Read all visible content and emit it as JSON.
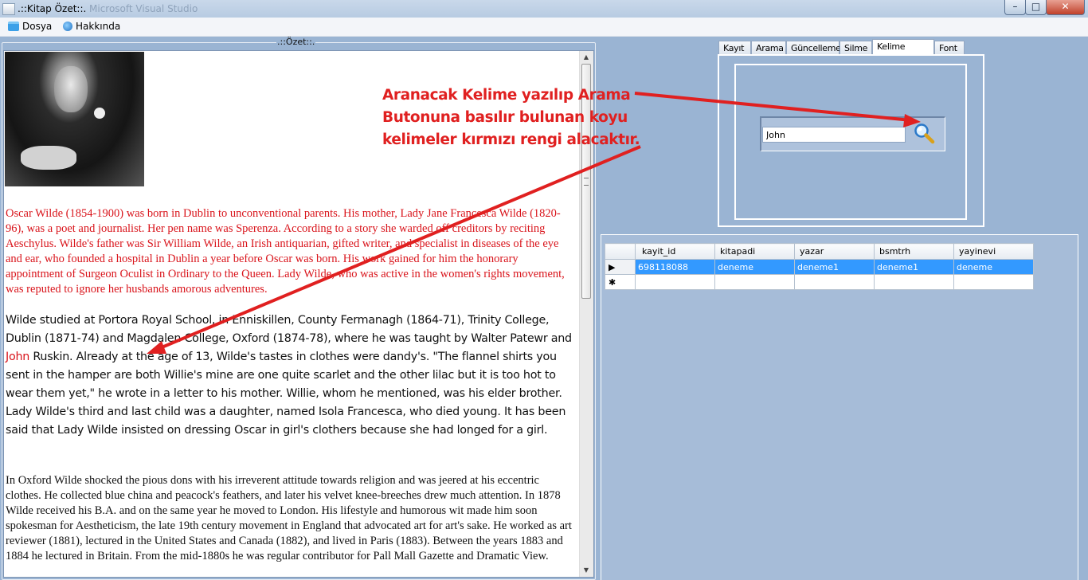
{
  "window": {
    "title": ".::Kitap Özet::.",
    "ghost_title": "Microsoft Visual Studio",
    "minimize": "–",
    "maximize": "□",
    "close": "✕"
  },
  "menu": {
    "items": [
      {
        "label": "Dosya",
        "icon": "folder-icon"
      },
      {
        "label": "Hakkında",
        "icon": "info-icon"
      }
    ]
  },
  "summary": {
    "group_label": ".::Özet::.",
    "paragraph1": "Oscar Wilde (1854-1900) was born in Dublin to unconventional parents. His mother, Lady Jane Francesca Wilde (1820-96), was a poet and journalist. Her pen name was Sperenza. According to a story she warded off creditors by reciting Aeschylus. Wilde's father was Sir William Wilde, an Irish antiquarian, gifted writer, and specialist in diseases of the eye and ear, who founded a hospital in Dublin a year before Oscar was born. His work gained for him the honorary appointment of Surgeon Oculist in Ordinary to the Queen. Lady Wilde, who was active in the women's rights movement, was reputed to ignore her husbands amorous adventures.",
    "paragraph2_before": "Wilde studied at Portora Royal School, in Enniskillen, County Fermanagh (1864-71), Trinity College, Dublin (1871-74) and Magdalen College, Oxford (1874-78), where he was taught by Walter Patewr and ",
    "paragraph2_highlight": "John",
    "paragraph2_after": " Ruskin. Already at the age of 13, Wilde's tastes in clothes were dandy's. \"The flannel shirts you sent in the hamper are both Willie's mine are one quite scarlet and the other lilac but it is too hot to wear them yet,\" he wrote in a letter to his mother. Willie, whom he mentioned, was his elder brother. Lady Wilde's third and last child was a daughter, named Isola Francesca, who died young. It has been said that Lady Wilde insisted on dressing Oscar in girl's clothers because she had longed for a girl.",
    "paragraph3": "In Oxford Wilde shocked the pious dons with his irreverent attitude towards religion and was jeered at his eccentric clothes. He collected blue china and peacock's feathers, and later his velvet knee-breeches drew much attention. In 1878 Wilde received his B.A. and on the same year he moved to London. His lifestyle and humorous wit made him soon spokesman for Aestheticism, the late 19th century movement in England that advocated art for art's sake. He worked as art reviewer (1881), lectured in the United States and Canada (1882), and lived in Paris (1883). Between the years 1883 and 1884 he lectured in Britain. From the mid-1880s he was regular contributor for Pall Mall Gazette and Dramatic View."
  },
  "tabs": [
    {
      "label": "Kayıt",
      "active": false
    },
    {
      "label": "Arama",
      "active": false
    },
    {
      "label": "Güncelleme",
      "active": false
    },
    {
      "label": "Silme",
      "active": false
    },
    {
      "label": "Kelime Arama",
      "active": true
    },
    {
      "label": "Font",
      "active": false
    }
  ],
  "search": {
    "value": "John",
    "button_icon": "magnifier-icon"
  },
  "grid": {
    "columns": [
      "kayit_id",
      "kitapadi",
      "yazar",
      "bsmtrh",
      "yayinevi"
    ],
    "rows": [
      {
        "cells": [
          "698118088",
          "deneme",
          "deneme1",
          "deneme1",
          "deneme"
        ],
        "selected": true,
        "indicator": "▶"
      }
    ],
    "new_row_indicator": "✱"
  },
  "annotation": {
    "line1": "Aranacak Kelime yazılıp Arama",
    "line2": "Butonuna basılır bulunan koyu",
    "line3": "kelimeler kırmızı rengi alacaktır.",
    "color": "#e02020"
  }
}
